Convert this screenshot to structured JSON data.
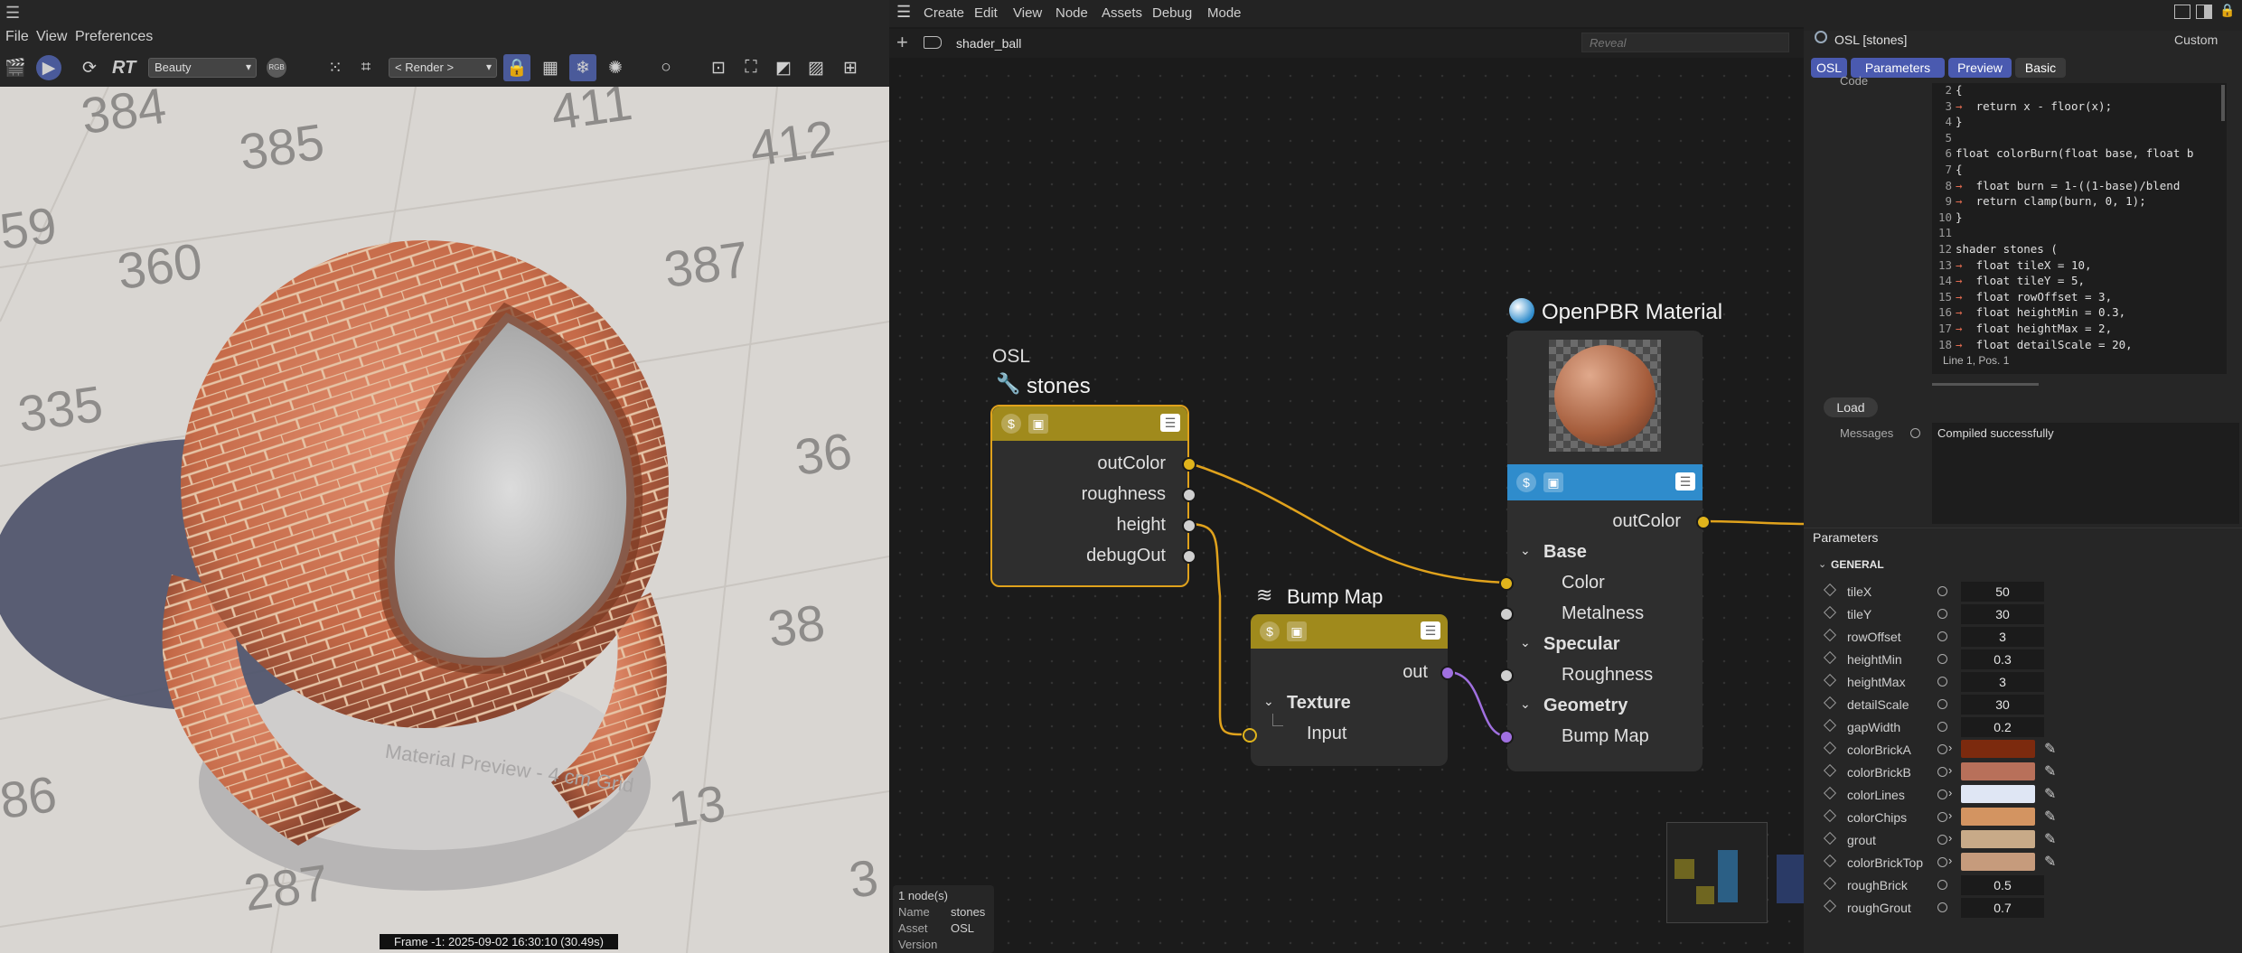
{
  "viewport": {
    "menu": [
      "File",
      "View",
      "Preferences"
    ],
    "render_label": "RT",
    "pass_select": "Beauty",
    "channel_label": "RGB",
    "render_select": "< Render >",
    "grid_numbers": [
      "384",
      "385",
      "411",
      "412",
      "59",
      "360",
      "387",
      "335",
      "36",
      "38",
      "86",
      "13",
      "287",
      "3"
    ],
    "material_text": "Material Preview - 4 cm Grid",
    "status": "Frame -1: 2025-09-02 16:30:10 (30.49s)"
  },
  "node_editor": {
    "menu": [
      "Create",
      "Edit",
      "View",
      "Node",
      "Assets",
      "Debug",
      "Mode"
    ],
    "breadcrumb": "shader_ball",
    "search_placeholder": "Reveal",
    "osl_node": {
      "type_label": "OSL",
      "name": "stones",
      "ports": [
        "outColor",
        "roughness",
        "height",
        "debugOut"
      ],
      "color": "#a08a1c"
    },
    "bump_node": {
      "name": "Bump Map",
      "out_port": "out",
      "group": "Texture",
      "input_port": "Input",
      "color": "#a08a1c"
    },
    "pbr_node": {
      "name": "OpenPBR Material",
      "out_port": "outColor",
      "groups": [
        {
          "label": "Base",
          "ports": [
            "Color",
            "Metalness"
          ]
        },
        {
          "label": "Specular",
          "ports": [
            "Roughness"
          ]
        },
        {
          "label": "Geometry",
          "ports": [
            "Bump Map"
          ]
        }
      ],
      "color": "#2f8ccc"
    },
    "info": {
      "count": "1 node(s)",
      "name_key": "Name",
      "name_val": "stones",
      "asset_key": "Asset",
      "asset_val": "OSL",
      "version_key": "Version"
    },
    "wire_colors": {
      "color": "#e0a21c",
      "vector": "#a070e0",
      "float": "#c8c8c8"
    }
  },
  "panel": {
    "title": "OSL [stones]",
    "layout_select": "Custom",
    "tabs": [
      "OSL",
      "Parameters",
      "Preview",
      "Basic"
    ],
    "code_label": "Code",
    "code_lines": [
      {
        "n": "2",
        "arrow": "",
        "text": "{"
      },
      {
        "n": "3",
        "arrow": "→",
        "text": "  return x - floor(x);"
      },
      {
        "n": "4",
        "arrow": "",
        "text": "}"
      },
      {
        "n": "5",
        "arrow": "",
        "text": ""
      },
      {
        "n": "6",
        "arrow": "",
        "text": "float colorBurn(float base, float b"
      },
      {
        "n": "7",
        "arrow": "",
        "text": "{"
      },
      {
        "n": "8",
        "arrow": "→",
        "text": "  float burn = 1-((1-base)/blend"
      },
      {
        "n": "9",
        "arrow": "→",
        "text": "  return clamp(burn, 0, 1);"
      },
      {
        "n": "10",
        "arrow": "",
        "text": "}"
      },
      {
        "n": "11",
        "arrow": "",
        "text": ""
      },
      {
        "n": "12",
        "arrow": "",
        "text": "shader stones ("
      },
      {
        "n": "13",
        "arrow": "→",
        "text": "  float tileX = 10,"
      },
      {
        "n": "14",
        "arrow": "→",
        "text": "  float tileY = 5,"
      },
      {
        "n": "15",
        "arrow": "→",
        "text": "  float rowOffset = 3,"
      },
      {
        "n": "16",
        "arrow": "→",
        "text": "  float heightMin = 0.3,"
      },
      {
        "n": "17",
        "arrow": "→",
        "text": "  float heightMax = 2,"
      },
      {
        "n": "18",
        "arrow": "→",
        "text": "  float detailScale = 20,"
      }
    ],
    "cursor_pos": "Line 1, Pos. 1",
    "load_label": "Load",
    "messages_label": "Messages",
    "messages_text": "Compiled successfully",
    "params_header": "Parameters",
    "general_header": "GENERAL",
    "params": [
      {
        "name": "tileX",
        "value": "50"
      },
      {
        "name": "tileY",
        "value": "30"
      },
      {
        "name": "rowOffset",
        "value": "3"
      },
      {
        "name": "heightMin",
        "value": "0.3"
      },
      {
        "name": "heightMax",
        "value": "3"
      },
      {
        "name": "detailScale",
        "value": "30"
      },
      {
        "name": "gapWidth",
        "value": "0.2"
      },
      {
        "name": "colorBrickA",
        "color": "#7c2a0e"
      },
      {
        "name": "colorBrickB",
        "color": "#b8705a"
      },
      {
        "name": "colorLines",
        "color": "#dfe6f4"
      },
      {
        "name": "colorChips",
        "color": "#d39461"
      },
      {
        "name": "grout",
        "color": "#c8aa88"
      },
      {
        "name": "colorBrickTop",
        "color": "#c69b7c"
      },
      {
        "name": "roughBrick",
        "value": "0.5"
      },
      {
        "name": "roughGrout",
        "value": "0.7"
      }
    ]
  }
}
